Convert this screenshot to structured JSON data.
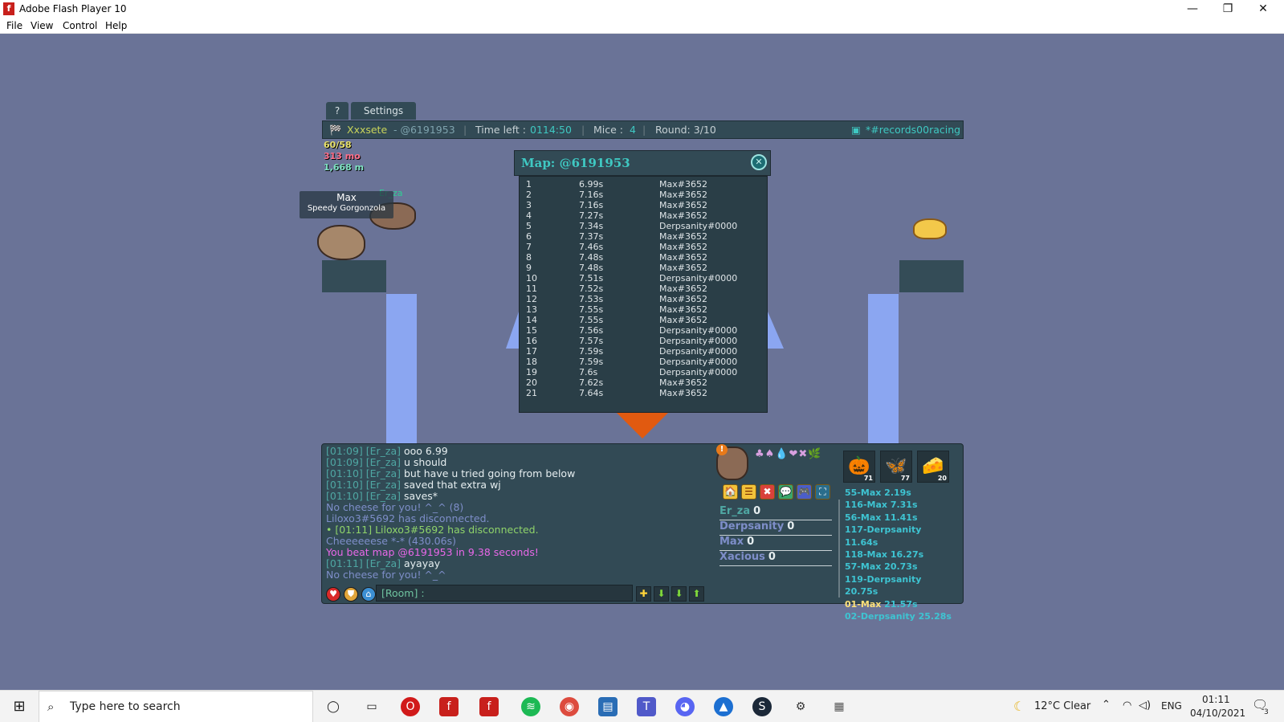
{
  "window": {
    "title": "Adobe Flash Player 10",
    "app_icon_glyph": "f",
    "controls": [
      "—",
      "❐",
      "✕"
    ]
  },
  "menu": [
    "File",
    "View",
    "Control",
    "Help"
  ],
  "tabs": {
    "help": "?",
    "settings": "Settings"
  },
  "status": {
    "player": "Xxxsete",
    "map_code": "- @6191953",
    "time_label": "Time left :",
    "time_value": "0114:50",
    "mice_label": "Mice :",
    "mice_value": "4",
    "round": "Round: 3/10",
    "room": "*#records00racing",
    "separator": "|"
  },
  "player_stats": [
    "60/58",
    "313 mo",
    "1,668 m"
  ],
  "other_player_name": "Er_za",
  "nametag": {
    "name": "Max",
    "title": "Speedy Gorgonzola"
  },
  "map_popup": {
    "title": "Map: @6191953",
    "close_glyph": "✕",
    "records": [
      {
        "rank": "1",
        "time": "6.99s",
        "player": "Max#3652"
      },
      {
        "rank": "2",
        "time": "7.16s",
        "player": "Max#3652"
      },
      {
        "rank": "3",
        "time": "7.16s",
        "player": "Max#3652"
      },
      {
        "rank": "4",
        "time": "7.27s",
        "player": "Max#3652"
      },
      {
        "rank": "5",
        "time": "7.34s",
        "player": "Derpsanity#0000"
      },
      {
        "rank": "6",
        "time": "7.37s",
        "player": "Max#3652"
      },
      {
        "rank": "7",
        "time": "7.46s",
        "player": "Max#3652"
      },
      {
        "rank": "8",
        "time": "7.48s",
        "player": "Max#3652"
      },
      {
        "rank": "9",
        "time": "7.48s",
        "player": "Max#3652"
      },
      {
        "rank": "10",
        "time": "7.51s",
        "player": "Derpsanity#0000"
      },
      {
        "rank": "11",
        "time": "7.52s",
        "player": "Max#3652"
      },
      {
        "rank": "12",
        "time": "7.53s",
        "player": "Max#3652"
      },
      {
        "rank": "13",
        "time": "7.55s",
        "player": "Max#3652"
      },
      {
        "rank": "14",
        "time": "7.55s",
        "player": "Max#3652"
      },
      {
        "rank": "15",
        "time": "7.56s",
        "player": "Derpsanity#0000"
      },
      {
        "rank": "16",
        "time": "7.57s",
        "player": "Derpsanity#0000"
      },
      {
        "rank": "17",
        "time": "7.59s",
        "player": "Derpsanity#0000"
      },
      {
        "rank": "18",
        "time": "7.59s",
        "player": "Derpsanity#0000"
      },
      {
        "rank": "19",
        "time": "7.6s",
        "player": "Derpsanity#0000"
      },
      {
        "rank": "20",
        "time": "7.62s",
        "player": "Max#3652"
      },
      {
        "rank": "21",
        "time": "7.64s",
        "player": "Max#3652"
      }
    ]
  },
  "chat": [
    {
      "text": "[01:09] [Er_za] ",
      "msg": "ooo 6.99",
      "color": "#4fa7a3"
    },
    {
      "text": "[01:09] [Er_za] ",
      "msg": "u should",
      "color": "#4fa7a3"
    },
    {
      "text": "[01:10] [Er_za] ",
      "msg": "but have u tried going from below",
      "color": "#4fa7a3"
    },
    {
      "text": "[01:10] [Er_za] ",
      "msg": "saved that extra wj",
      "color": "#4fa7a3"
    },
    {
      "text": "[01:10] [Er_za] ",
      "msg": "saves*",
      "color": "#4fa7a3"
    },
    {
      "text": "No cheese for you! ^_^ (8)",
      "msg": "",
      "color": "#7e8ec9"
    },
    {
      "text": "Liloxo3",
      "msg": "#5692 has disconnected.",
      "color": "#7e8ec9"
    },
    {
      "text": "• [01:11] Liloxo3",
      "msg": "#5692 has disconnected.",
      "color": "#8fd36a"
    },
    {
      "text": "Cheeeeeese *-* (430.06s)",
      "msg": "",
      "color": "#7e8ec9"
    },
    {
      "text": "You beat map @6191953 in 9.38 seconds!",
      "msg": "",
      "color": "#e968e9"
    },
    {
      "text": "[01:11] [Er_za] ",
      "msg": "ayayay",
      "color": "#4fa7a3"
    },
    {
      "text": "No cheese for you! ^_^",
      "msg": "",
      "color": "#7e8ec9"
    }
  ],
  "chat_input": {
    "prefix": "[Room] :"
  },
  "chat_buttons": [
    "✚",
    "⬇",
    "⬇",
    "⬆"
  ],
  "badges": [
    {
      "icon": "pumpkin-icon",
      "glyph": "🎃",
      "count": "71"
    },
    {
      "icon": "butterfly-icon",
      "glyph": "🦋",
      "count": "77"
    },
    {
      "icon": "cheese-block-icon",
      "glyph": "🧀",
      "count": "20"
    }
  ],
  "tools": [
    "🏠",
    "☰",
    "✖",
    "💬",
    "🎮",
    "⛶"
  ],
  "scoreboard": [
    {
      "name": "Er_za",
      "score": "0",
      "color": "#4fa7a3"
    },
    {
      "name": "Derpsanity",
      "score": "0",
      "color": "#7e8ec9"
    },
    {
      "name": "Max",
      "score": "0",
      "color": "#7e8ec9"
    },
    {
      "name": "Xacious",
      "score": "0",
      "color": "#7e8ec9"
    }
  ],
  "round_records": [
    {
      "text": "55-Max 2.19s",
      "color": "#3ec4d2"
    },
    {
      "text": "116-Max 7.31s",
      "color": "#3ec4d2"
    },
    {
      "text": "56-Max 11.41s",
      "color": "#3ec4d2"
    },
    {
      "text": "117-Derpsanity 11.64s",
      "color": "#3ec4d2"
    },
    {
      "text": "118-Max 16.27s",
      "color": "#3ec4d2"
    },
    {
      "text": "57-Max 20.73s",
      "color": "#3ec4d2"
    },
    {
      "text": "119-Derpsanity 20.75s",
      "color": "#3ec4d2"
    },
    {
      "text": "01-Max",
      "extra": " 21.57s",
      "color": "#ffe27a"
    },
    {
      "text": "02-Derpsanity 25.28s",
      "color": "#3ec4d2"
    }
  ],
  "taskbar": {
    "search_placeholder": "Type here to search",
    "weather": "12°C  Clear",
    "language": "ENG",
    "time": "01:11",
    "date": "04/10/2021",
    "notification_count": "3"
  },
  "colors": {
    "game_bg": "#6a7397",
    "panel": "#324a55",
    "accent_cyan": "#3fc8c2",
    "pillar": "#8ba6f1"
  }
}
